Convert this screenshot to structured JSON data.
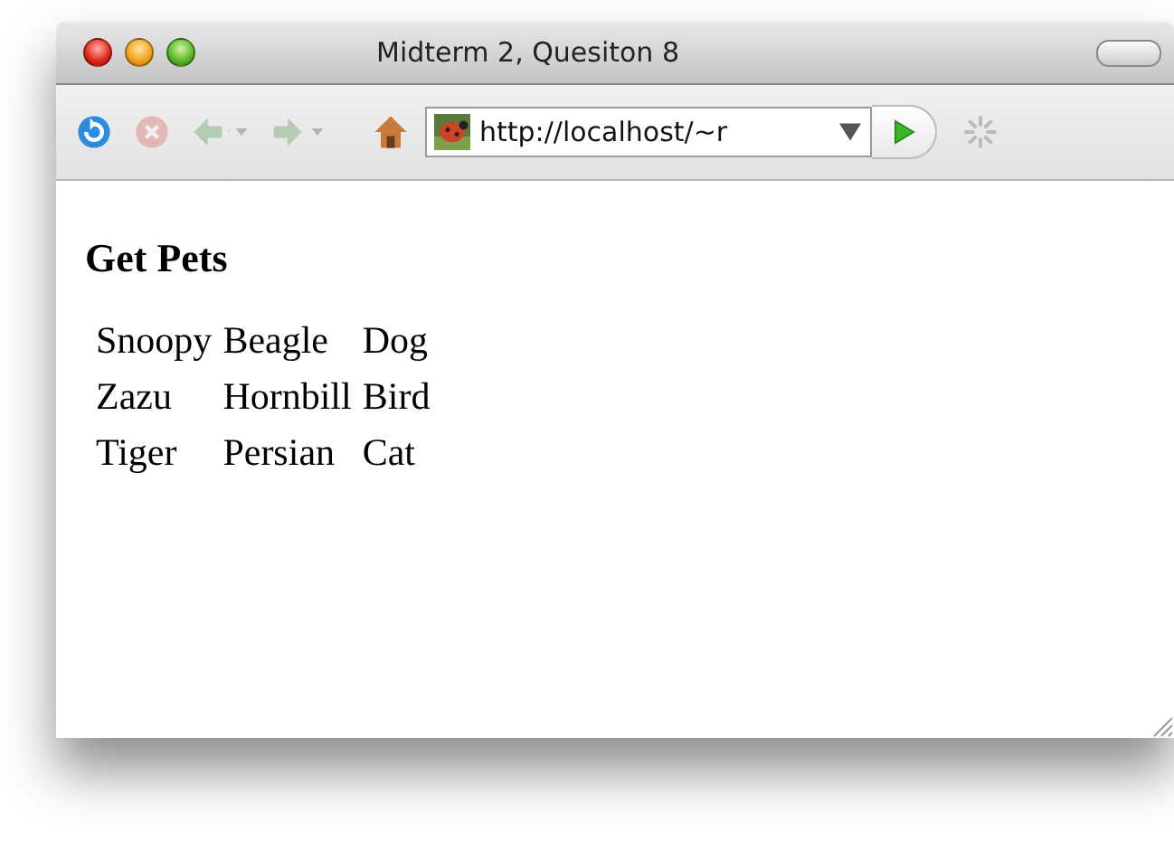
{
  "window": {
    "title": "Midterm 2, Quesiton 8"
  },
  "toolbar": {
    "buttons": [
      {
        "kind": "reload",
        "disabled": false
      },
      {
        "kind": "stop",
        "disabled": true
      },
      {
        "kind": "back",
        "disabled": true
      },
      {
        "kind": "forward",
        "disabled": true
      },
      {
        "kind": "home",
        "disabled": false
      }
    ],
    "address": {
      "value": "http://localhost/~r"
    }
  },
  "page": {
    "heading": "Get Pets",
    "table": {
      "rows": [
        [
          "Snoopy",
          "Beagle",
          "Dog"
        ],
        [
          "Zazu",
          "Hornbill",
          "Bird"
        ],
        [
          "Tiger",
          "Persian",
          "Cat"
        ]
      ]
    }
  }
}
